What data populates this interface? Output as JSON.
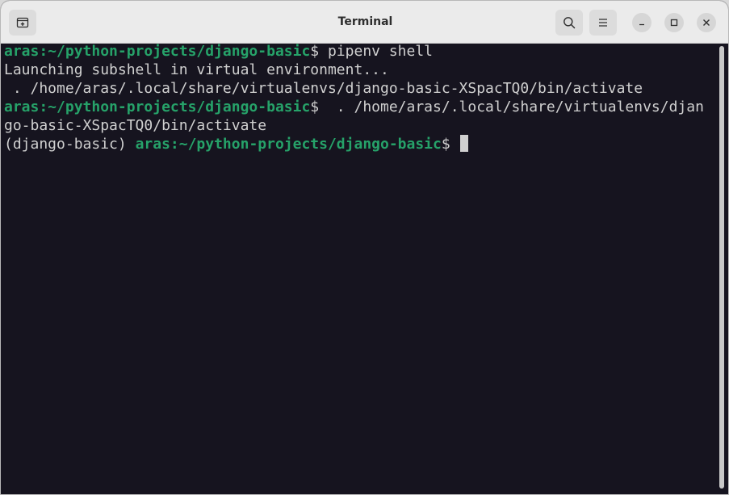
{
  "window": {
    "title": "Terminal"
  },
  "titlebar": {
    "new_tab_icon": "new-tab-icon",
    "search_icon": "search-icon",
    "menu_icon": "hamburger-menu-icon",
    "minimize_icon": "minimize-icon",
    "maximize_icon": "maximize-icon",
    "close_icon": "close-icon"
  },
  "terminal": {
    "lines": [
      {
        "prompt": "aras:~/python-projects/django-basic",
        "text": "$ pipenv shell"
      },
      {
        "prompt": "",
        "text": "Launching subshell in virtual environment..."
      },
      {
        "prompt": "",
        "text": " . /home/aras/.local/share/virtualenvs/django-basic-XSpacTQ0/bin/activate"
      },
      {
        "prompt": "aras:~/python-projects/django-basic",
        "text": "$  . /home/aras/.local/share/virtualenvs/djan"
      },
      {
        "prompt": "",
        "text": "go-basic-XSpacTQ0/bin/activate"
      }
    ],
    "current_env": "(django-basic) ",
    "current_prompt": "aras:~/python-projects/django-basic",
    "current_suffix": "$ "
  },
  "colors": {
    "background": "#16141f",
    "prompt_green": "#26a269",
    "text": "#d0d0d0",
    "titlebar": "#ebebeb"
  }
}
